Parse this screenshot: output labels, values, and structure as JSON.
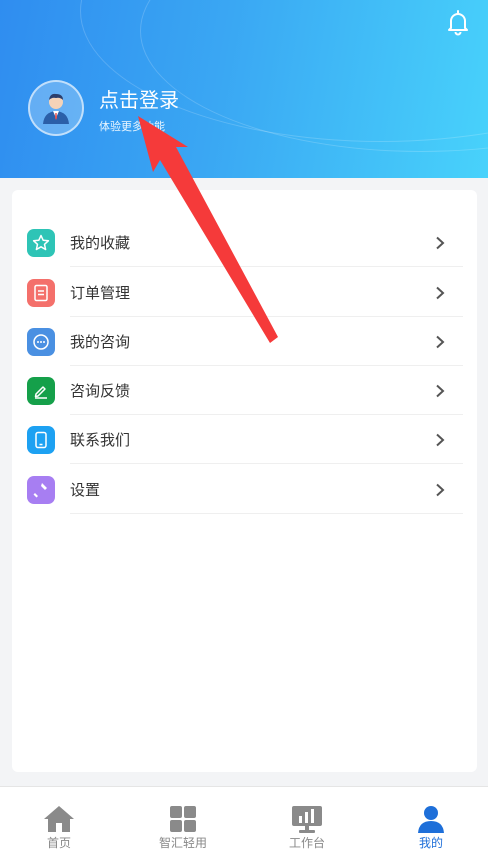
{
  "header": {
    "login_title": "点击登录",
    "login_subtitle": "体验更多功能",
    "notification_icon": "bell-icon"
  },
  "menu": [
    {
      "label": "我的收藏",
      "icon": "star-icon",
      "color": "#2ec4b6"
    },
    {
      "label": "订单管理",
      "icon": "document-icon",
      "color": "#f4706b"
    },
    {
      "label": "我的咨询",
      "icon": "chat-bubble-icon",
      "color": "#4a90e2"
    },
    {
      "label": "咨询反馈",
      "icon": "edit-pen-icon",
      "color": "#15a04a"
    },
    {
      "label": "联系我们",
      "icon": "phone-icon",
      "color": "#1da1f2"
    },
    {
      "label": "设置",
      "icon": "wrench-icon",
      "color": "#a77ef2"
    }
  ],
  "tabbar": {
    "items": [
      {
        "label": "首页",
        "icon": "home-icon",
        "active": false
      },
      {
        "label": "智汇轻用",
        "icon": "grid-icon",
        "active": false
      },
      {
        "label": "工作台",
        "icon": "monitor-chart-icon",
        "active": false
      },
      {
        "label": "我的",
        "icon": "person-icon",
        "active": true
      }
    ],
    "active_color": "#1e6fd9",
    "inactive_color": "#888888"
  },
  "annotation": {
    "arrow_color": "#f53a3a"
  }
}
